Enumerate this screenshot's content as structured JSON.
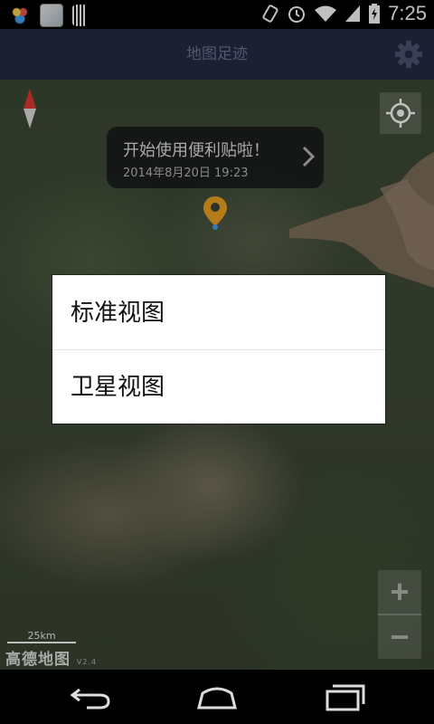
{
  "status_bar": {
    "time": "7:25",
    "battery_icon": "battery-charging-icon",
    "icons": [
      "rotation-icon",
      "alarm-icon",
      "wifi-icon",
      "signal-icon"
    ]
  },
  "title_bar": {
    "title": "地图足迹",
    "settings_icon": "gear-icon"
  },
  "map": {
    "info_bubble": {
      "message": "开始使用便利贴啦！",
      "date": "2014年8月20日 19:23"
    },
    "zoom_in_label": "+",
    "zoom_out_label": "−",
    "scale_label": "25km",
    "logo_text": "高德地图",
    "logo_version": "V2.4"
  },
  "dialog": {
    "options": [
      {
        "label": "标准视图"
      },
      {
        "label": "卫星视图"
      }
    ]
  },
  "nav_bar": {
    "icons": [
      "back-icon",
      "home-icon",
      "recent-apps-icon"
    ]
  },
  "colors": {
    "title_bar_bg": "#242c44",
    "title_text": "#6b7595",
    "pin": "#f5a623"
  }
}
